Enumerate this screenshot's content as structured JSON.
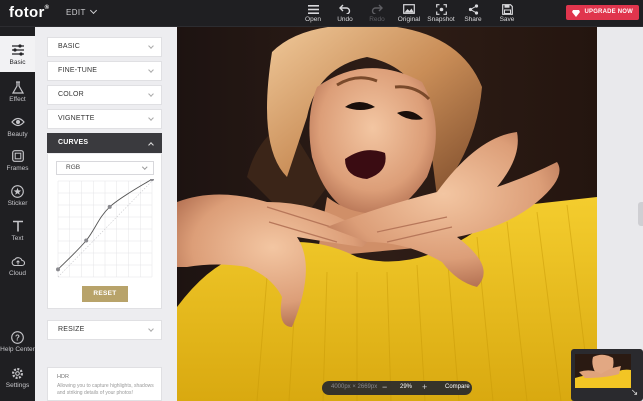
{
  "brand": {
    "logo": "fotor",
    "mark": "®"
  },
  "menu": {
    "edit_label": "EDIT"
  },
  "toolbar": [
    {
      "label": "Open",
      "icon": "menu-icon",
      "disabled": false
    },
    {
      "label": "Undo",
      "icon": "undo-icon",
      "disabled": false
    },
    {
      "label": "Redo",
      "icon": "redo-icon",
      "disabled": true
    },
    {
      "label": "Original",
      "icon": "image-icon",
      "disabled": false
    },
    {
      "label": "Snapshot",
      "icon": "snapshot-icon",
      "disabled": false
    },
    {
      "label": "Share",
      "icon": "share-icon",
      "disabled": false
    },
    {
      "label": "Save",
      "icon": "save-icon",
      "disabled": false
    }
  ],
  "upgrade": {
    "label": "UPGRADE NOW",
    "icon": "gem-icon",
    "color": "#e0354d"
  },
  "rail": [
    {
      "label": "Basic",
      "icon": "sliders-icon",
      "active": true
    },
    {
      "label": "Effect",
      "icon": "flask-icon",
      "active": false
    },
    {
      "label": "Beauty",
      "icon": "eye-icon",
      "active": false
    },
    {
      "label": "Frames",
      "icon": "frame-icon",
      "active": false
    },
    {
      "label": "Sticker",
      "icon": "star-icon",
      "active": false
    },
    {
      "label": "Text",
      "icon": "text-icon",
      "active": false
    },
    {
      "label": "Cloud",
      "icon": "cloud-icon",
      "active": false
    },
    {
      "label": "Help Center",
      "icon": "question-icon",
      "active": false
    },
    {
      "label": "Settings",
      "icon": "gear-icon",
      "active": false
    }
  ],
  "panel": {
    "sections": [
      {
        "label": "BASIC"
      },
      {
        "label": "FINE-TUNE"
      },
      {
        "label": "COLOR"
      },
      {
        "label": "VIGNETTE"
      },
      {
        "label": "CURVES",
        "expanded": true
      }
    ],
    "curves": {
      "channel": "RGB",
      "reset_label": "RESET",
      "points": [
        [
          0,
          0.08
        ],
        [
          0.3,
          0.38
        ],
        [
          0.55,
          0.73
        ],
        [
          1,
          1.02
        ]
      ]
    },
    "resize_label": "RESIZE",
    "hdr": {
      "title": "HDR",
      "description": "Allowing you to capture highlights, shadows and striking details of your photos!"
    }
  },
  "canvas": {
    "dimensions": "4000px × 2669px",
    "zoom": "29%",
    "zoom_out": "−",
    "zoom_in": "+",
    "compare_label": "Compare",
    "collapse_icon": "↘"
  },
  "colors": {
    "accent_gold": "#b8a36a",
    "shirt_yellow": "#f2c524",
    "active_section": "#3a3a3e"
  }
}
